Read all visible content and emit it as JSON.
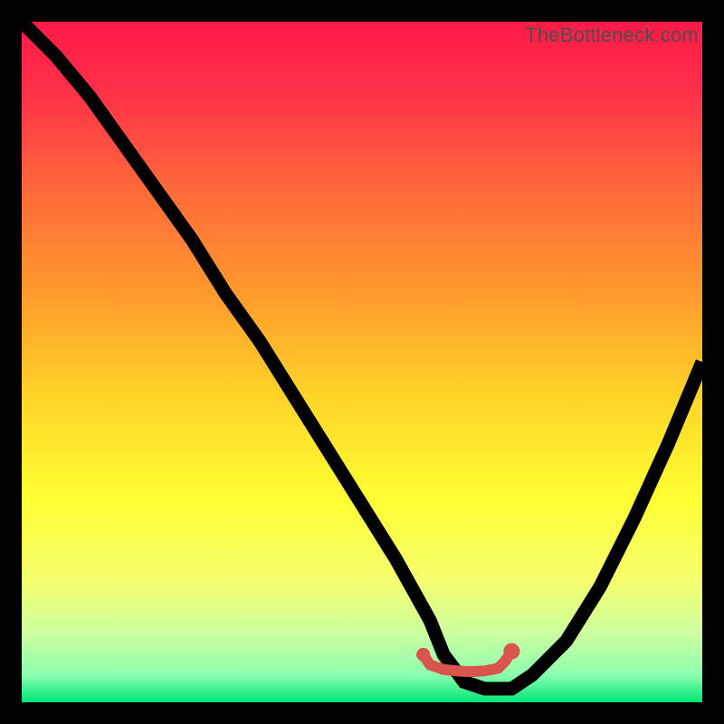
{
  "watermark": "TheBottleneck.com",
  "chart_data": {
    "type": "line",
    "title": "",
    "xlabel": "",
    "ylabel": "",
    "xlim": [
      0,
      100
    ],
    "ylim": [
      0,
      100
    ],
    "background_gradient": {
      "type": "vertical",
      "stops": [
        {
          "pos": 0.0,
          "color": "#ff1a47"
        },
        {
          "pos": 0.1,
          "color": "#ff2f49"
        },
        {
          "pos": 0.25,
          "color": "#ff6a3a"
        },
        {
          "pos": 0.4,
          "color": "#ff9a2e"
        },
        {
          "pos": 0.55,
          "color": "#ffd428"
        },
        {
          "pos": 0.7,
          "color": "#ffff33"
        },
        {
          "pos": 0.82,
          "color": "#f6ff6e"
        },
        {
          "pos": 0.9,
          "color": "#ccffa0"
        },
        {
          "pos": 0.96,
          "color": "#8cffb0"
        },
        {
          "pos": 1.0,
          "color": "#00e676"
        }
      ]
    },
    "series": [
      {
        "name": "bottleneck-curve",
        "x": [
          0,
          5,
          10,
          15,
          20,
          25,
          30,
          35,
          40,
          45,
          50,
          55,
          60,
          62,
          65,
          68,
          70,
          72,
          75,
          80,
          85,
          90,
          95,
          100
        ],
        "y": [
          100,
          95,
          89,
          82,
          75,
          68,
          60,
          53,
          45,
          37,
          29,
          21,
          12,
          7,
          3,
          2,
          2,
          2,
          4,
          9,
          17,
          27,
          38,
          50
        ]
      }
    ],
    "highlight_segment": {
      "name": "flat-bottom",
      "color": "#d9544d",
      "points": [
        {
          "x": 59,
          "y": 7.0
        },
        {
          "x": 60,
          "y": 5.5
        },
        {
          "x": 62,
          "y": 4.8
        },
        {
          "x": 64,
          "y": 4.6
        },
        {
          "x": 66,
          "y": 4.5
        },
        {
          "x": 68,
          "y": 4.6
        },
        {
          "x": 70,
          "y": 5.0
        },
        {
          "x": 71,
          "y": 6.0
        },
        {
          "x": 72,
          "y": 7.5
        }
      ],
      "end_dots": [
        {
          "x": 59,
          "y": 7.0,
          "r": 1.0
        },
        {
          "x": 72,
          "y": 7.5,
          "r": 1.2
        }
      ]
    }
  }
}
